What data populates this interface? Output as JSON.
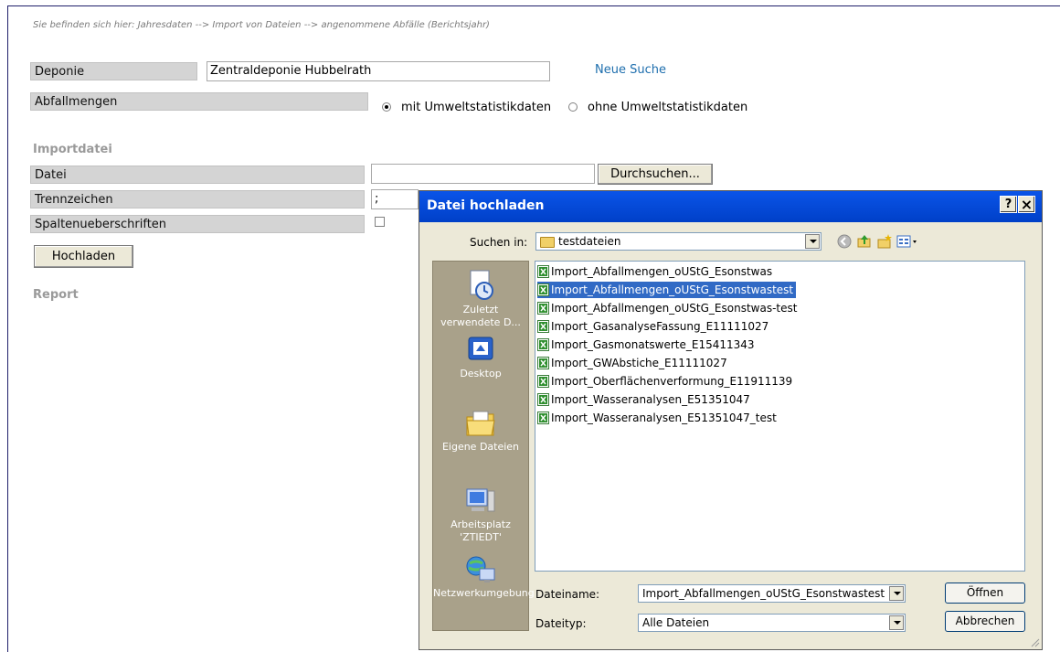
{
  "breadcrumb": "Sie befinden sich hier: Jahresdaten --> Import von Dateien --> angenommene Abfälle (Berichtsjahr)",
  "form": {
    "deponie_label": "Deponie",
    "deponie_value": "Zentraldeponie Hubbelrath",
    "neue_suche": "Neue Suche",
    "abfallmengen_label": "Abfallmengen",
    "radio_with": "mit Umweltstatistikdaten",
    "radio_without": "ohne Umweltstatistikdaten",
    "radio_selected": "mit Umweltstatistikdaten",
    "importdatei_heading": "Importdatei",
    "datei_label": "Datei",
    "datei_value": "",
    "browse_button": "Durchsuchen...",
    "trennzeichen_label": "Trennzeichen",
    "trennzeichen_value": ";",
    "spalten_label": "Spaltenueberschriften",
    "spalten_checked": false,
    "upload_button": "Hochladen",
    "report_heading": "Report"
  },
  "dialog": {
    "title": "Datei hochladen",
    "help_button": "?",
    "close_button": "×",
    "look_in_label": "Suchen in:",
    "look_in_value": "testdateien",
    "places": [
      {
        "label": "Zuletzt verwendete D...",
        "icon": "recent-documents-icon"
      },
      {
        "label": "Desktop",
        "icon": "desktop-icon"
      },
      {
        "label": "Eigene Dateien",
        "icon": "my-documents-icon"
      },
      {
        "label": "Arbeitsplatz 'ZTIEDT'",
        "icon": "my-computer-icon"
      },
      {
        "label": "Netzwerkumgebung",
        "icon": "network-icon"
      }
    ],
    "files": [
      "Import_Abfallmengen_oUStG_Esonstwas",
      "Import_Abfallmengen_oUStG_Esonstwastest",
      "Import_Abfallmengen_oUStG_Esonstwas-test",
      "Import_GasanalyseFassung_E11111027",
      "Import_Gasmonatswerte_E15411343",
      "Import_GWAbstiche_E11111027",
      "Import_Oberflächenverformung_E11911139",
      "Import_Wasseranalysen_E51351047",
      "Import_Wasseranalysen_E51351047_test"
    ],
    "selected_file": "Import_Abfallmengen_oUStG_Esonstwastest",
    "filename_label": "Dateiname:",
    "filename_value": "Import_Abfallmengen_oUStG_Esonstwastest",
    "filetype_label": "Dateityp:",
    "filetype_value": "Alle Dateien",
    "open_button": "Öffnen",
    "cancel_button": "Abbrechen"
  },
  "colors": {
    "title_bar": "#0a54e8",
    "selection": "#316ac5",
    "label_bg": "#d4d4d4",
    "link": "#1f6fae",
    "places_bar": "#a9a18a"
  }
}
